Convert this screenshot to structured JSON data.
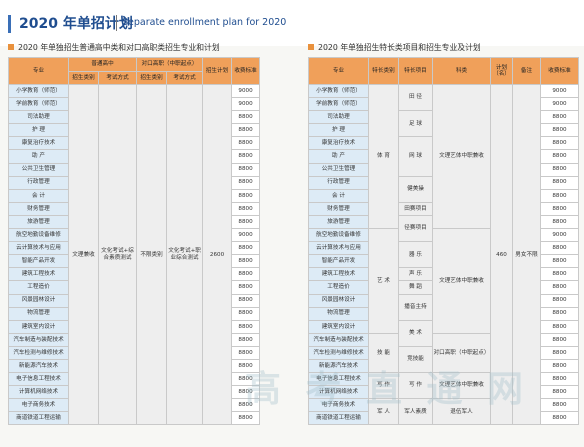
{
  "header": {
    "title": "2020 年单招计划",
    "subtitle": "Separate enrollment plan for 2020"
  },
  "left": {
    "section_title": "2020 年单独招生普通高中类和对口高职类招生专业和计划",
    "headers": {
      "major": "专业",
      "general": "普通高中",
      "vocational": "对口高职（中职起点）",
      "plan": "招生计划",
      "fee": "收费标准",
      "category": "招生类别",
      "exam": "考试方式"
    },
    "general_category": "文理兼收",
    "general_exam": "文化考试+综合素质测试",
    "vocational_category": "不限类别",
    "vocational_exam": "文化考试+职业综合测试",
    "plan_total": "2600",
    "rows": [
      {
        "name": "小学教育（师范）",
        "fee": "9000"
      },
      {
        "name": "学前教育（师范）",
        "fee": "9000"
      },
      {
        "name": "司法助理",
        "fee": "8800"
      },
      {
        "name": "护 理",
        "fee": "8800"
      },
      {
        "name": "康复治疗技术",
        "fee": "8800"
      },
      {
        "name": "助 产",
        "fee": "8800"
      },
      {
        "name": "公共卫生管理",
        "fee": "8800"
      },
      {
        "name": "行政管理",
        "fee": "8800"
      },
      {
        "name": "会 计",
        "fee": "8800"
      },
      {
        "name": "财务管理",
        "fee": "8800"
      },
      {
        "name": "旅游管理",
        "fee": "8800"
      },
      {
        "name": "航空地勤设备维修",
        "fee": "9000"
      },
      {
        "name": "云计算技术与应用",
        "fee": "8800"
      },
      {
        "name": "智能产品开发",
        "fee": "8800"
      },
      {
        "name": "建筑工程技术",
        "fee": "8800"
      },
      {
        "name": "工程造价",
        "fee": "8800"
      },
      {
        "name": "风景园林设计",
        "fee": "8800"
      },
      {
        "name": "物流管理",
        "fee": "8800"
      },
      {
        "name": "建筑室内设计",
        "fee": "8800"
      },
      {
        "name": "汽车制造与装配技术",
        "fee": "8800"
      },
      {
        "name": "汽车检测与维修技术",
        "fee": "8800"
      },
      {
        "name": "新能源汽车技术",
        "fee": "8800"
      },
      {
        "name": "电子信息工程技术",
        "fee": "8800"
      },
      {
        "name": "计算机网络技术",
        "fee": "8800"
      },
      {
        "name": "电子商务技术",
        "fee": "8800"
      },
      {
        "name": "商道铁道工程运输",
        "fee": "8800"
      }
    ]
  },
  "right": {
    "section_title": "2020 年单独招生特长类项目和招生专业及计划",
    "headers": {
      "major": "专业",
      "category": "特长类别",
      "item": "特长项目",
      "subject": "科类",
      "plan": "计划（名）",
      "note": "备注",
      "fee": "收费标准"
    },
    "plan_total": "460",
    "note": "男女不限",
    "rows": [
      {
        "name": "小学教育（师范）",
        "fee": "9000"
      },
      {
        "name": "学前教育（师范）",
        "fee": "9000"
      },
      {
        "name": "司法助理",
        "fee": "8800"
      },
      {
        "name": "护 理",
        "fee": "8800"
      },
      {
        "name": "康复治疗技术",
        "fee": "8800"
      },
      {
        "name": "助 产",
        "fee": "8800"
      },
      {
        "name": "公共卫生管理",
        "fee": "8800"
      },
      {
        "name": "行政管理",
        "fee": "8800"
      },
      {
        "name": "会 计",
        "fee": "8800"
      },
      {
        "name": "财务管理",
        "fee": "8800"
      },
      {
        "name": "旅游管理",
        "fee": "8800"
      },
      {
        "name": "航空地勤设备维修",
        "fee": "9000"
      },
      {
        "name": "云计算技术与应用",
        "fee": "8800"
      },
      {
        "name": "智能产品开发",
        "fee": "8800"
      },
      {
        "name": "建筑工程技术",
        "fee": "8800"
      },
      {
        "name": "工程造价",
        "fee": "8800"
      },
      {
        "name": "风景园林设计",
        "fee": "8800"
      },
      {
        "name": "物流管理",
        "fee": "8800"
      },
      {
        "name": "建筑室内设计",
        "fee": "8800"
      },
      {
        "name": "汽车制造与装配技术",
        "fee": "8800"
      },
      {
        "name": "汽车检测与维修技术",
        "fee": "8800"
      },
      {
        "name": "新能源汽车技术",
        "fee": "8800"
      },
      {
        "name": "电子信息工程技术",
        "fee": "8800"
      },
      {
        "name": "计算机网络技术",
        "fee": "8800"
      },
      {
        "name": "电子商务技术",
        "fee": "8800"
      },
      {
        "name": "商道铁道工程运输",
        "fee": "8800"
      }
    ],
    "categories": {
      "sports": "体 育",
      "art": "艺 术",
      "skill": "技 能",
      "writing": "写 作",
      "military": "军 人"
    },
    "items": {
      "i1": "田 径",
      "i2": "足 球",
      "i3": "网 球",
      "i4": "健美操",
      "i5": "田赛项目",
      "i6": "径赛项目",
      "i7": "器 乐",
      "i8": "声 乐",
      "i9": "舞 蹈",
      "i10": "播音主持",
      "i11": "美 术",
      "i12": "竞技能",
      "i13": "写 作",
      "i14": "军人素质"
    },
    "subjects": {
      "s1": "文理艺体中职兼收",
      "s2": "文理艺体中职兼收",
      "s3": "对口高职（中职起点）",
      "s4": "文理艺体中职兼收",
      "s5": "退伍军人"
    }
  },
  "watermark": "高 考 直 通 网"
}
